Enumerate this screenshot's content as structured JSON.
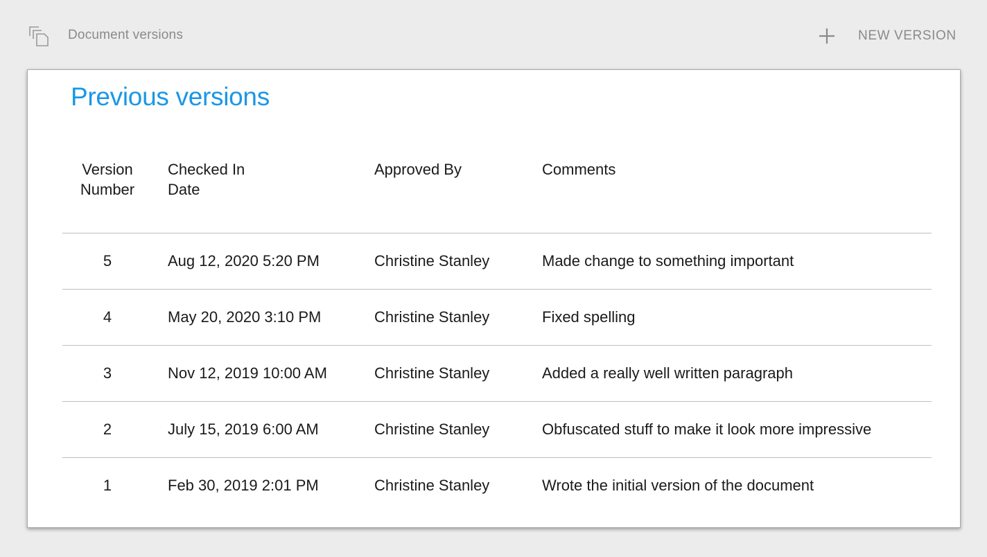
{
  "header": {
    "icon": "copy-documents-icon",
    "title": "Document versions",
    "new_version": {
      "icon": "plus-icon",
      "label": "NEW VERSION"
    }
  },
  "card": {
    "title": "Previous versions"
  },
  "table": {
    "columns": [
      "Version Number",
      "Checked In Date",
      "Approved By",
      "Comments"
    ],
    "rows": [
      {
        "version": "5",
        "date": "Aug 12, 2020 5:20 PM",
        "approved_by": "Christine Stanley",
        "comment": "Made change to something important"
      },
      {
        "version": "4",
        "date": "May 20, 2020 3:10 PM",
        "approved_by": "Christine Stanley",
        "comment": "Fixed spelling"
      },
      {
        "version": "3",
        "date": "Nov 12, 2019 10:00 AM",
        "approved_by": "Christine Stanley",
        "comment": "Added a really well written paragraph"
      },
      {
        "version": "2",
        "date": "July 15, 2019 6:00 AM",
        "approved_by": "Christine Stanley",
        "comment": "Obfuscated stuff to make it look more impressive"
      },
      {
        "version": "1",
        "date": "Feb 30, 2019 2:01 PM",
        "approved_by": "Christine Stanley",
        "comment": "Wrote the initial version of the document"
      }
    ]
  },
  "colors": {
    "accent": "#1a97e6",
    "header_text": "#8a8a8a",
    "background": "#ececec"
  }
}
